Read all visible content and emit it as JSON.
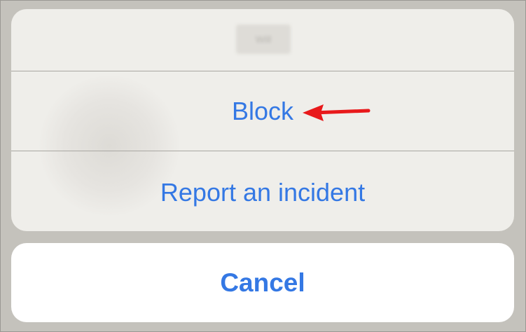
{
  "action_sheet": {
    "header_name": "Will",
    "options": [
      {
        "label": "Block"
      },
      {
        "label": "Report an incident"
      }
    ],
    "cancel_label": "Cancel"
  },
  "annotation": {
    "arrow_icon": "red-arrow-left-icon",
    "arrow_color": "#e8191b"
  },
  "colors": {
    "accent": "#3478e4",
    "sheet_background": "#efeeea",
    "dim_background": "#c4c2bc"
  }
}
